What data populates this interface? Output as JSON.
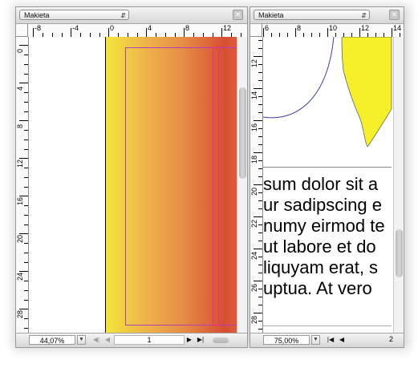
{
  "left_pane": {
    "layout_select": "Makieta",
    "ruler_h": [
      "-8",
      "-4",
      "0",
      "4",
      "8",
      "12"
    ],
    "ruler_v": [
      "0",
      "4",
      "8",
      "12",
      "16",
      "20",
      "24",
      "28"
    ],
    "zoom": "44,07%",
    "page": "1"
  },
  "right_pane": {
    "layout_select": "Makieta",
    "ruler_h": [
      "6",
      "8",
      "10",
      "12",
      "14"
    ],
    "ruler_v": [
      "12",
      "14",
      "16",
      "18",
      "20",
      "22",
      "24",
      "26",
      "28"
    ],
    "zoom": "75,00%",
    "page": "2",
    "text_lines": [
      "sum dolor sit a",
      "ur sadipscing e",
      "numy eirmod te",
      "ut labore et do",
      "liquyam erat, s",
      "uptua. At vero"
    ]
  },
  "icons": {
    "dropdown": "chevron-updown-icon",
    "close": "close-icon",
    "first": "first-page-icon",
    "prev": "previous-page-icon",
    "next": "next-page-icon",
    "last": "last-page-icon"
  },
  "colors": {
    "gradient": [
      "#f4e63a",
      "#d74e34"
    ],
    "frame": "#b040b8",
    "guide": "#ee2a8a",
    "yellow_shape": "#f5f02a"
  }
}
